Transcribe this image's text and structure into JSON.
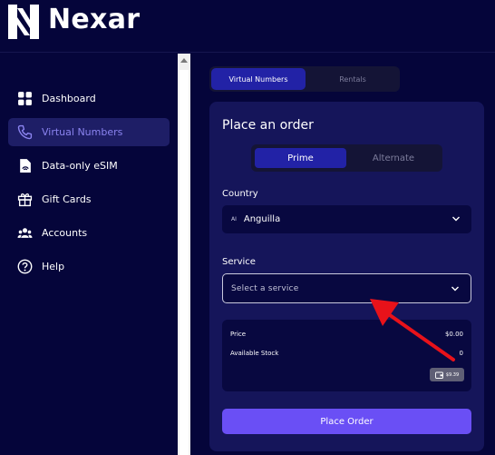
{
  "brand": {
    "name": "Nexar"
  },
  "sidebar": {
    "items": [
      {
        "label": "Dashboard",
        "icon": "dashboard-icon",
        "active": false
      },
      {
        "label": "Virtual Numbers",
        "icon": "phone-icon",
        "active": true
      },
      {
        "label": "Data-only eSIM",
        "icon": "esim-icon",
        "active": false
      },
      {
        "label": "Gift Cards",
        "icon": "gift-icon",
        "active": false
      },
      {
        "label": "Accounts",
        "icon": "users-icon",
        "active": false
      },
      {
        "label": "Help",
        "icon": "help-icon",
        "active": false
      }
    ]
  },
  "tabs": [
    {
      "label": "Virtual Numbers",
      "active": true
    },
    {
      "label": "Rentals",
      "active": false
    }
  ],
  "order": {
    "title": "Place an order",
    "segments": [
      {
        "label": "Prime",
        "active": true
      },
      {
        "label": "Alternate",
        "active": false
      }
    ],
    "country_label": "Country",
    "country_code": "AI",
    "country_value": "Anguilla",
    "service_label": "Service",
    "service_placeholder": "Select a service",
    "price_label": "Price",
    "price_value": "$0.00",
    "stock_label": "Available Stock",
    "stock_value": "0",
    "balance": "$9.39",
    "submit_label": "Place Order"
  },
  "colors": {
    "background": "#05053a",
    "card": "#15155a",
    "accent": "#6a4ff5",
    "active_tab": "#2222a6",
    "annotation_arrow": "#e8121a"
  }
}
